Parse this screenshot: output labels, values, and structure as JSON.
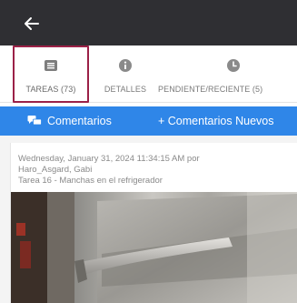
{
  "header": {
    "back_icon": "arrow-left-icon"
  },
  "tabs": [
    {
      "label": "TAREAS (73)",
      "icon": "list-icon",
      "active": true
    },
    {
      "label": "DETALLES",
      "icon": "info-icon",
      "active": false
    },
    {
      "label": "PENDIENTE/RECIENTE (5)",
      "icon": "clock-icon",
      "active": false
    }
  ],
  "actions": {
    "comments_label": "Comentarios",
    "new_comments_label": "+ Comentarios Nuevos"
  },
  "entry": {
    "timestamp": "Wednesday, January 31, 2024 11:34:15 AM por",
    "author": "Haro_Asgard, Gabi",
    "task": "Tarea 16 - Manchas en el refrigerador"
  },
  "colors": {
    "header_bg": "#2f2f33",
    "accent": "#2f86e8",
    "active_tab_border": "#9b2147"
  }
}
